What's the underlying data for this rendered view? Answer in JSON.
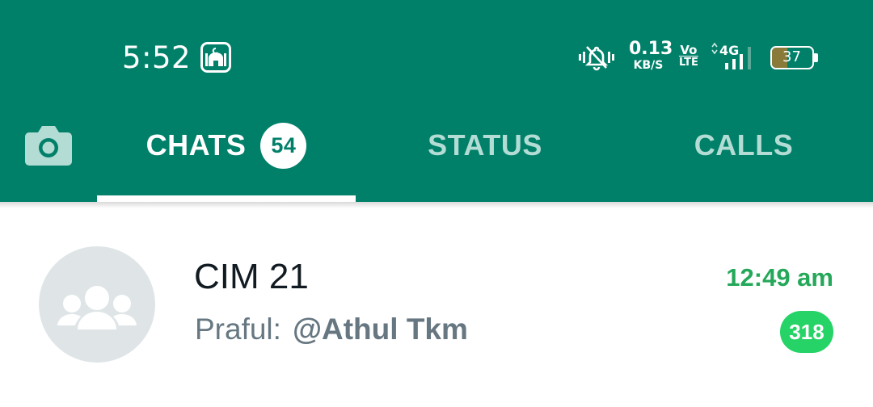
{
  "status_bar": {
    "time": "5:52",
    "speed_value": "0.13",
    "speed_unit": "KB/S",
    "volte_top": "Vo",
    "volte_bottom": "LTE",
    "network": "4G",
    "battery": "37",
    "battery_level_percent": 37,
    "icons": [
      "mosque-icon",
      "mute-icon",
      "signal-icon",
      "battery-icon"
    ]
  },
  "tabs": {
    "camera_icon": "camera-icon",
    "items": [
      {
        "label": "CHATS",
        "badge": "54",
        "active": true
      },
      {
        "label": "STATUS",
        "active": false
      },
      {
        "label": "CALLS",
        "active": false
      }
    ]
  },
  "chats": [
    {
      "name": "CIM 21",
      "sender": "Praful:",
      "message": "@Athul Tkm",
      "time": "12:49 am",
      "unread": "318",
      "avatar_icon": "group-icon"
    }
  ],
  "colors": {
    "header": "#008069",
    "inactive_tab": "#b3dcd4",
    "unread_badge": "#25d366",
    "time_accent": "#25a85a"
  }
}
